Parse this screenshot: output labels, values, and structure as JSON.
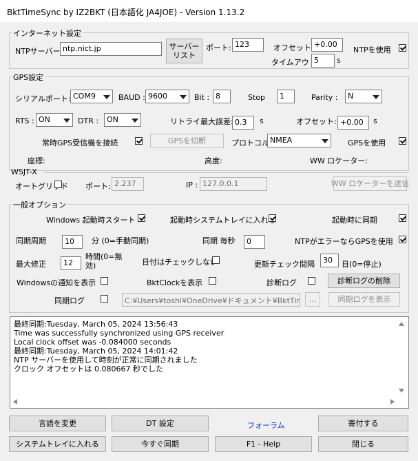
{
  "window": {
    "title": "BktTimeSync by IZ2BKT (日本語化 JA4JOE) - Version 1.13.2"
  },
  "internet": {
    "group_label": "インターネット設定",
    "ntp_server_label": "NTPサーバー",
    "ntp_server_value": "ntp.nict.jp",
    "server_list_line1": "サーバー",
    "server_list_line2": "リスト",
    "port_label": "ポート:",
    "port_value": "123",
    "offset_label": "オフセット:",
    "offset_value": "+0.00",
    "use_ntp_label": "NTPを使用",
    "use_ntp_checked": true,
    "timeout_label": "タイムアウト:",
    "timeout_value": "5",
    "timeout_unit": "s"
  },
  "gps": {
    "group_label": "GPS設定",
    "serial_port_label": "シリアルポート:",
    "serial_port_value": "COM9",
    "baud_label": "BAUD :",
    "baud_value": "9600",
    "bit_label": "Bit :",
    "bit_value": "8",
    "stop_label": "Stop",
    "stop_value": "1",
    "parity_label": "Parity :",
    "parity_value": "N",
    "rts_label": "RTS :",
    "rts_value": "ON",
    "dtr_label": "DTR :",
    "dtr_value": "ON",
    "retry_label": "リトライ最大誤差:",
    "retry_value": "0.3",
    "retry_unit": "s",
    "offset_label": "オフセット:",
    "offset_value": "+0.00",
    "offset_unit": "s",
    "always_connect_label": "常時GPS受信機を接続",
    "always_connect_checked": true,
    "disconnect_button": "GPSを切断",
    "protocol_label": "プロトコル:",
    "protocol_value": "NMEA",
    "use_gps_label": "GPSを使用",
    "use_gps_checked": true,
    "coords_label": "座標:",
    "altitude_label": "高度:",
    "locator_label": "WW ロケーター:"
  },
  "wsjtx": {
    "group_label": "WSJT-X",
    "autogrid_label": "オートグリッド",
    "autogrid_checked": false,
    "port_label": "ポート:",
    "port_value": "2.237",
    "ip_label": "IP :",
    "ip_value": "127.0.0.1",
    "send_locator_button": "WW ロケーターを送信"
  },
  "general": {
    "group_label": "一般オプション",
    "start_with_windows_label": "Windows 起動時スタート",
    "start_with_windows_checked": true,
    "tray_on_start_label": "起動時システムトレイに入れる",
    "tray_on_start_checked": true,
    "sync_on_start_label": "起動時に同期",
    "sync_on_start_checked": true,
    "sync_period_label": "同期周期",
    "sync_period_value": "10",
    "sync_period_unit": "分 (0=手動同期)",
    "sync_every_sec_label": "同期 毎秒",
    "sync_every_sec_value": "0",
    "gps_on_ntp_error_label": "NTPがエラーならGPSを使用",
    "gps_on_ntp_error_checked": true,
    "max_correction_label": "最大修正",
    "max_correction_value": "12",
    "max_correction_unit_line1": "時間(0=無",
    "max_correction_unit_line2": "効)",
    "no_date_check_label": "日付はチェックしない",
    "no_date_check_checked": false,
    "update_check_label": "更新チェック間隔",
    "update_check_value": "30",
    "update_check_unit": "日(0=停止)",
    "windows_notify_label": "Windowsの通知を表示",
    "windows_notify_checked": false,
    "show_bktclock_label": "BktClockを表示",
    "show_bktclock_checked": false,
    "diag_log_label": "診断ログ",
    "diag_log_checked": false,
    "delete_diag_log_button": "診断ログの削除",
    "sync_log_label": "同期ログ",
    "sync_log_checked": false,
    "sync_log_path": "C:¥Users¥toshi¥OneDrive¥ドキュメント¥BktTimeSyncL",
    "browse_button": "...",
    "show_sync_log_button": "同期ログを表示"
  },
  "log": {
    "lines": [
      "最終同期:Tuesday, March 05, 2024 13:56:43",
      "Time was successfully synchronized using GPS receiver",
      "Local clock offset was -0.084000 seconds",
      "最終同期:Tuesday, March 05, 2024 14:01:42",
      "NTP サーバーを使用して時刻が正常に同期されました",
      "クロック オフセットは 0.080667 秒でした"
    ]
  },
  "footer": {
    "change_language": "言語を変更",
    "dt_settings": "DT 設定",
    "forum_link": "フォーラム",
    "donate": "寄付する",
    "to_tray": "システムトレイに入れる",
    "sync_now": "今すぐ同期",
    "help": "F1 - Help",
    "close": "閉じる"
  },
  "colors": {
    "background": "#f0f0f0",
    "link": "#0033cc"
  }
}
